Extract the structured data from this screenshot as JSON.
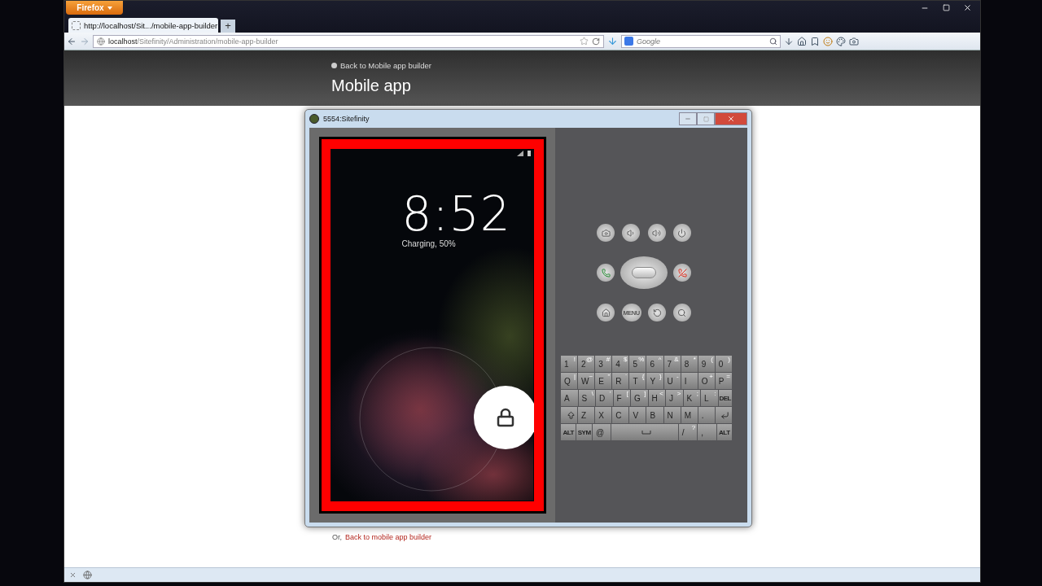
{
  "browser": {
    "menu_button": "Firefox",
    "tabs": [
      {
        "title": "http://localhost/Sit.../mobile-app-builder",
        "selected": true
      }
    ],
    "new_tab": "+",
    "address": {
      "host": "localhost",
      "path": "/Sitefinity/Administration/mobile-app-builder"
    },
    "search": {
      "placeholder": "Google"
    }
  },
  "page": {
    "back_link": "Back to Mobile app builder",
    "title": "Mobile app",
    "footer": {
      "prefix": "Or,",
      "link": "Back to mobile app builder"
    }
  },
  "emulator": {
    "title": "5554:Sitefinity",
    "lock_screen": {
      "time": "8:52",
      "status": "Charging, 50%"
    },
    "controls": [
      [
        {
          "kind": "camera"
        },
        {
          "kind": "volume-down"
        },
        {
          "kind": "volume-up"
        },
        {
          "kind": "power"
        }
      ],
      [
        {
          "kind": "call"
        },
        {
          "kind": "dpad"
        },
        {
          "kind": "hangup"
        }
      ],
      [
        {
          "kind": "home"
        },
        {
          "kind": "menu",
          "label": "MENU"
        },
        {
          "kind": "back"
        },
        {
          "kind": "search"
        }
      ]
    ],
    "keyboard": [
      [
        {
          "kind": "char",
          "key": "1",
          "alt": "!"
        },
        {
          "kind": "char",
          "key": "2",
          "alt": "@"
        },
        {
          "kind": "char",
          "key": "3",
          "alt": "#"
        },
        {
          "kind": "char",
          "key": "4",
          "alt": "$"
        },
        {
          "kind": "char",
          "key": "5",
          "alt": "%"
        },
        {
          "kind": "char",
          "key": "6",
          "alt": "^"
        },
        {
          "kind": "char",
          "key": "7",
          "alt": "&"
        },
        {
          "kind": "char",
          "key": "8",
          "alt": "*"
        },
        {
          "kind": "char",
          "key": "9",
          "alt": "("
        },
        {
          "kind": "char",
          "key": "0",
          "alt": ")"
        }
      ],
      [
        {
          "kind": "char",
          "key": "Q",
          "alt": "|"
        },
        {
          "kind": "char",
          "key": "W",
          "alt": "~"
        },
        {
          "kind": "char",
          "key": "E",
          "alt": "\""
        },
        {
          "kind": "char",
          "key": "R",
          "alt": "`"
        },
        {
          "kind": "char",
          "key": "T",
          "alt": "{"
        },
        {
          "kind": "char",
          "key": "Y",
          "alt": "}"
        },
        {
          "kind": "char",
          "key": "U",
          "alt": "-"
        },
        {
          "kind": "char",
          "key": "I"
        },
        {
          "kind": "char",
          "key": "O",
          "alt": "+"
        },
        {
          "kind": "char",
          "key": "P",
          "alt": "="
        }
      ],
      [
        {
          "kind": "char",
          "key": "A"
        },
        {
          "kind": "char",
          "key": "S",
          "alt": "\\"
        },
        {
          "kind": "char",
          "key": "D",
          "alt": "'"
        },
        {
          "kind": "char",
          "key": "F",
          "alt": "["
        },
        {
          "kind": "char",
          "key": "G",
          "alt": "]"
        },
        {
          "kind": "char",
          "key": "H",
          "alt": "<"
        },
        {
          "kind": "char",
          "key": "J",
          "alt": ">"
        },
        {
          "kind": "char",
          "key": "K",
          "alt": ";"
        },
        {
          "kind": "char",
          "key": "L",
          "alt": ":"
        },
        {
          "kind": "del",
          "key": "DEL"
        }
      ],
      [
        {
          "kind": "shift"
        },
        {
          "kind": "char",
          "key": "Z"
        },
        {
          "kind": "char",
          "key": "X"
        },
        {
          "kind": "char",
          "key": "C"
        },
        {
          "kind": "char",
          "key": "V"
        },
        {
          "kind": "char",
          "key": "B"
        },
        {
          "kind": "char",
          "key": "N"
        },
        {
          "kind": "char",
          "key": "M"
        },
        {
          "kind": "char",
          "key": "."
        },
        {
          "kind": "enter"
        }
      ],
      [
        {
          "kind": "label",
          "key": "ALT"
        },
        {
          "kind": "label",
          "key": "SYM"
        },
        {
          "kind": "char",
          "key": "@"
        },
        {
          "kind": "space"
        },
        {
          "kind": "char",
          "key": "/",
          "alt": "?"
        },
        {
          "kind": "char",
          "key": ","
        },
        {
          "kind": "label",
          "key": "ALT"
        }
      ]
    ]
  }
}
